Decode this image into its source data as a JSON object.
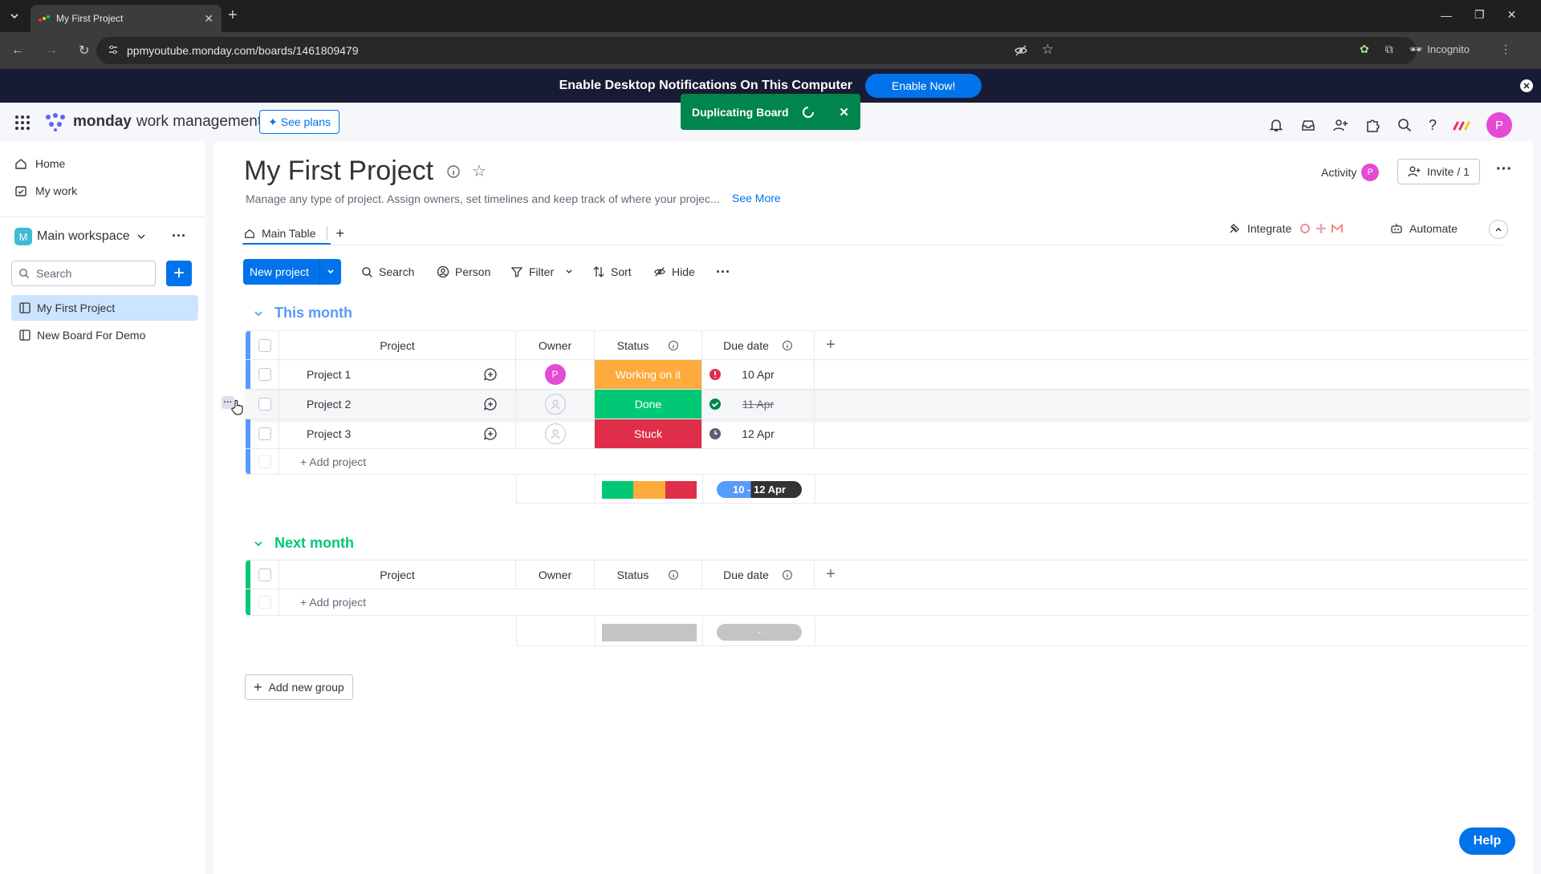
{
  "browser": {
    "tab_title": "My First Project",
    "url": "ppmyoutube.monday.com/boards/1461809479",
    "incognito_label": "Incognito",
    "profile_letter": "P"
  },
  "notification_bar": {
    "text": "Enable Desktop Notifications On This Computer",
    "button": "Enable Now!"
  },
  "toast": {
    "text": "Duplicating Board"
  },
  "header": {
    "brand": "monday",
    "brand_suffix": "work management",
    "see_plans": "See plans",
    "avatar_letter": "P"
  },
  "sidebar": {
    "home": "Home",
    "my_work": "My work",
    "workspace_letter": "M",
    "workspace": "Main workspace",
    "search_placeholder": "Search",
    "boards": [
      {
        "label": "My First Project",
        "selected": true
      },
      {
        "label": "New Board For Demo",
        "selected": false
      }
    ]
  },
  "board": {
    "title": "My First Project",
    "description": "Manage any type of project. Assign owners, set timelines and keep track of where your projec...",
    "see_more": "See More",
    "activity": "Activity",
    "activity_avatar": "P",
    "invite": "Invite / 1",
    "main_tab": "Main Table",
    "integrate": "Integrate",
    "automate": "Automate"
  },
  "toolbar": {
    "new_project": "New project",
    "search": "Search",
    "person": "Person",
    "filter": "Filter",
    "sort": "Sort",
    "hide": "Hide"
  },
  "columns": {
    "project": "Project",
    "owner": "Owner",
    "status": "Status",
    "due_date": "Due date"
  },
  "groups": [
    {
      "title": "This month",
      "color": "#579bfc",
      "rows": [
        {
          "name": "Project 1",
          "owner": "P",
          "status": "Working on it",
          "status_color": "#fdab3d",
          "due": "10 Apr",
          "due_icon": "alert"
        },
        {
          "name": "Project 2",
          "owner": "",
          "status": "Done",
          "status_color": "#00c875",
          "due": "11 Apr",
          "due_icon": "check"
        },
        {
          "name": "Project 3",
          "owner": "",
          "status": "Stuck",
          "status_color": "#df2f4a",
          "due": "12 Apr",
          "due_icon": "clock"
        }
      ],
      "add_label": "+ Add project",
      "summary_timeline": "10 - 12 Apr"
    },
    {
      "title": "Next month",
      "color": "#00c875",
      "rows": [],
      "add_label": "+ Add project",
      "summary_timeline": "-"
    }
  ],
  "add_group": "Add new group",
  "help": "Help",
  "colors": {
    "primary": "#0073ea",
    "working": "#fdab3d",
    "done": "#00c875",
    "stuck": "#df2f4a"
  }
}
